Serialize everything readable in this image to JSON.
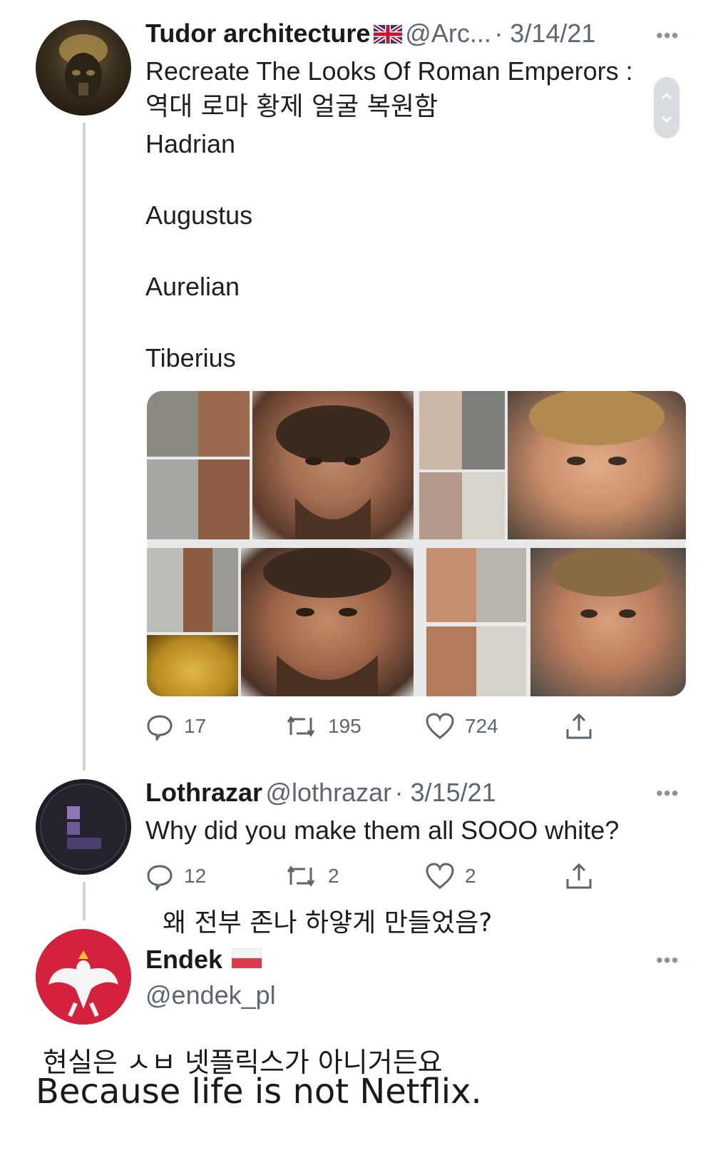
{
  "tweet1": {
    "name": "Tudor architecture",
    "flag": "🇬🇧",
    "handle": "@Arc...",
    "date": "· 3/14/21",
    "lines": [
      "Recreate The Looks Of Roman Emperors :",
      "역대 로마 황제 얼굴 복원함",
      "Hadrian",
      "Augustus",
      "Aurelian",
      "Tiberius"
    ],
    "actions": {
      "reply": "17",
      "retweet": "195",
      "like": "724"
    }
  },
  "tweet2": {
    "name": "Lothrazar",
    "handle": "@lothrazar",
    "date": "· 3/15/21",
    "text": "Why did you make them all SOOO white?",
    "actions": {
      "reply": "12",
      "retweet": "2",
      "like": "2"
    },
    "translation": "왜 전부 존나 하얗게 만들었음?"
  },
  "tweet3": {
    "name": "Endek",
    "flag": "🇵🇱",
    "handle": "@endek_pl"
  },
  "caption": {
    "korean": "현실은 ㅅㅂ 넷플릭스가 아니거든요",
    "english": "Because life is not Netflix."
  },
  "more_label": "•••",
  "icons": {
    "reply": "reply-icon",
    "retweet": "retweet-icon",
    "like": "heart-icon",
    "share": "share-icon",
    "more": "more-icon"
  },
  "colors": {
    "text": "#1f1f1f",
    "muted": "#5b6670",
    "thread_line": "#cfd4d9",
    "polish_red": "#d4213d"
  }
}
